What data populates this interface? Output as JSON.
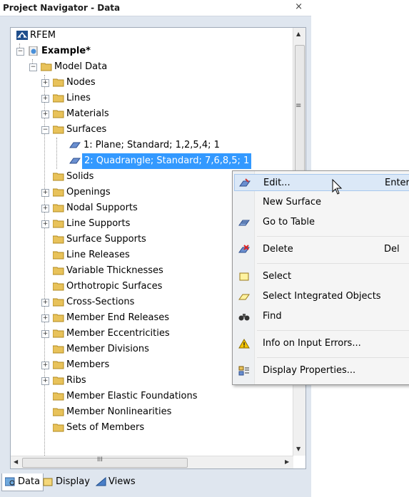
{
  "panel": {
    "title": "Project Navigator - Data",
    "close": "×"
  },
  "tree": {
    "root": "RFEM",
    "project": "Example*",
    "model_data": "Model Data",
    "items": [
      "Nodes",
      "Lines",
      "Materials",
      "Surfaces",
      "1: Plane; Standard; 1,2,5,4; 1",
      "2: Quadrangle; Standard; 7,6,8,5; 1",
      "Solids",
      "Openings",
      "Nodal Supports",
      "Line Supports",
      "Surface Supports",
      "Line Releases",
      "Variable Thicknesses",
      "Orthotropic Surfaces",
      "Cross-Sections",
      "Member End Releases",
      "Member Eccentricities",
      "Member Divisions",
      "Members",
      "Ribs",
      "Member Elastic Foundations",
      "Member Nonlinearities",
      "Sets of Members"
    ]
  },
  "scroll": {
    "grip": "≡",
    "hthumb": "III"
  },
  "tabs": [
    "Data",
    "Display",
    "Views"
  ],
  "menu": {
    "items": [
      {
        "label": "Edit...",
        "shortcut": "Enter",
        "icon": "edit-icon"
      },
      {
        "label": "New Surface",
        "shortcut": "",
        "icon": ""
      },
      {
        "label": "Go to Table",
        "shortcut": "",
        "icon": "table-icon"
      },
      {
        "label": "Delete",
        "shortcut": "Del",
        "icon": "delete-icon"
      },
      {
        "label": "Select",
        "shortcut": "",
        "icon": "select-icon"
      },
      {
        "label": "Select Integrated Objects",
        "shortcut": "",
        "icon": "select-integrated-icon"
      },
      {
        "label": "Find",
        "shortcut": "",
        "icon": "binoculars-icon"
      },
      {
        "label": "Info on Input Errors...",
        "shortcut": "",
        "icon": "warning-icon"
      },
      {
        "label": "Display Properties...",
        "shortcut": "",
        "icon": "display-properties-icon"
      }
    ]
  },
  "colors": {
    "selection": "#3399ff",
    "folder": "#e8c25a",
    "panel_bg": "#dfe6ef"
  }
}
